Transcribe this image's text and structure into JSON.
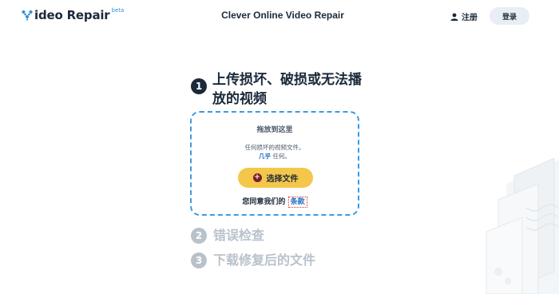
{
  "header": {
    "logo": {
      "prefix_icon": "v-logo-icon",
      "text": "ideo Repair",
      "badge": "beta"
    },
    "title": "Clever Online Video Repair",
    "register_label": "注册",
    "login_label": "登录"
  },
  "steps": [
    {
      "number": "1",
      "title": "上传损坏、破损或无法播放的视频",
      "active": true
    },
    {
      "number": "2",
      "title": "错误检查",
      "active": false
    },
    {
      "number": "3",
      "title": "下载修复后的文件",
      "active": false
    }
  ],
  "dropzone": {
    "drop_label": "拖放到这里",
    "hint_line1": "任何损坏的视频文件。",
    "hint_line2_strong": "几乎",
    "hint_line2_rest": " 任何。",
    "select_button_label": "选择文件",
    "terms_prefix": "您同意我们的",
    "terms_link": "条款"
  },
  "colors": {
    "primary_dark": "#1b2a3a",
    "accent_blue": "#3a9be0",
    "button_yellow": "#f4c64a",
    "inactive_gray": "#b9c2cb"
  }
}
